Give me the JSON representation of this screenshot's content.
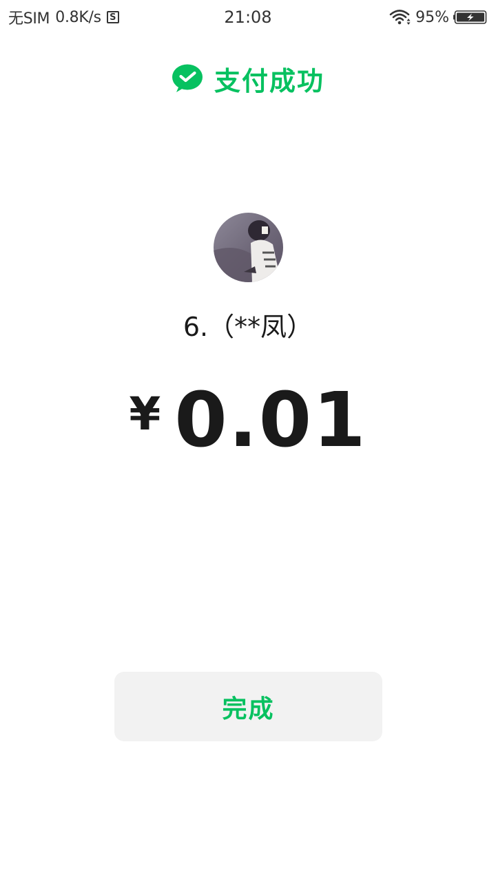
{
  "status_bar": {
    "sim": "无SIM",
    "net_speed": "0.8K/s",
    "s_icon_label": "S",
    "time": "21:08",
    "battery_percent": "95%",
    "icons": [
      "s-badge-icon",
      "wifi-icon",
      "battery-charging-icon"
    ]
  },
  "header": {
    "icon": "wechat-pay-icon",
    "title": "支付成功"
  },
  "payee": {
    "avatar": "avatar-photo",
    "name": "6.（**凤）"
  },
  "amount": {
    "currency": "¥",
    "value": "0.01"
  },
  "actions": {
    "done_label": "完成"
  },
  "colors": {
    "accent": "#07c160",
    "text": "#1a1a1a",
    "button_bg": "#f2f2f2"
  }
}
